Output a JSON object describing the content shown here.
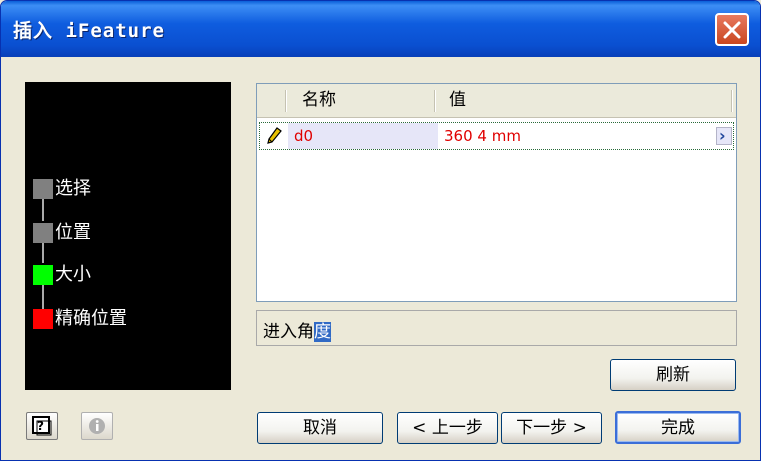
{
  "window": {
    "title": "插入 iFeature"
  },
  "steps": [
    {
      "label": "选择",
      "color": "#808080"
    },
    {
      "label": "位置",
      "color": "#808080"
    },
    {
      "label": "大小",
      "color": "#00ff00"
    },
    {
      "label": "精确位置",
      "color": "#ff0000"
    }
  ],
  "grid": {
    "columns": [
      "名称",
      "值"
    ],
    "rows": [
      {
        "name": "d0",
        "value": "360 4 mm"
      }
    ],
    "value_color": "#e00000"
  },
  "status": {
    "text_prefix": "进入角",
    "text_highlight": "度"
  },
  "buttons": {
    "refresh": "刷新",
    "cancel": "取消",
    "back": "< 上一步",
    "next": "下一步 >",
    "finish": "完成"
  },
  "icons": {
    "help": "help-icon",
    "info": "info-icon",
    "edit": "pencil-icon",
    "expand": "chevron-right-icon",
    "close": "close-icon"
  }
}
